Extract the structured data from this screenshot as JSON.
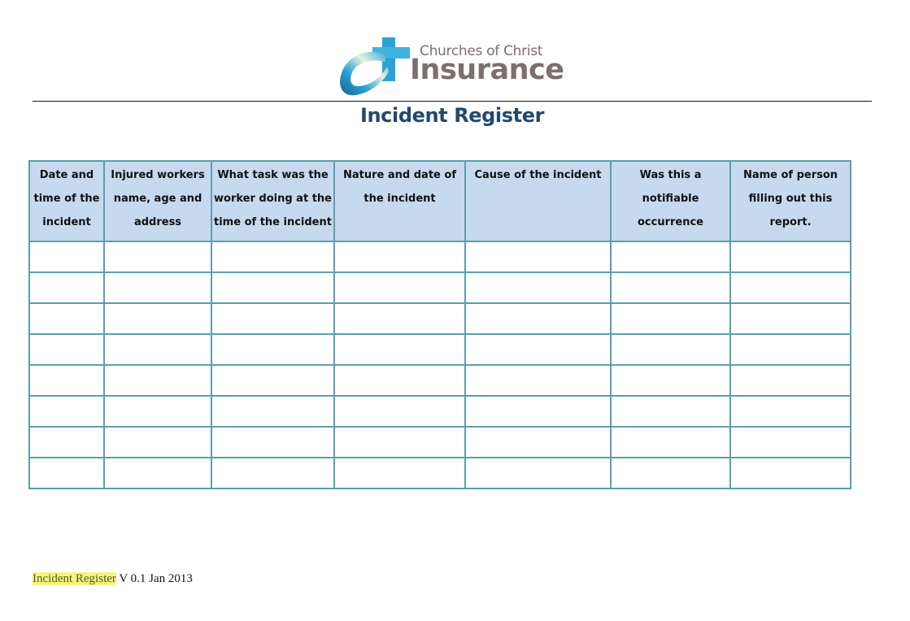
{
  "logo": {
    "line1": "Churches of Christ",
    "line2": "Insurance",
    "icon": "fish-cross-icon",
    "colors": {
      "blue": "#2aa3d9",
      "dark_blue": "#17628a",
      "light": "#d9ecd0",
      "text": "#7a706c"
    }
  },
  "document": {
    "title": "Incident Register",
    "title_color": "#24476f"
  },
  "table": {
    "header_bg": "#c6d9ef",
    "border_color": "#5aa0ac",
    "columns": [
      "Date and time of the incident",
      "Injured workers name, age and address",
      "What task was the worker doing at the time of the incident",
      "Nature and date of the incident",
      "Cause of the incident",
      "Was this a notifiable occurrence",
      "Name of person filling out this report."
    ],
    "rows": [
      [
        "",
        "",
        "",
        "",
        "",
        "",
        ""
      ],
      [
        "",
        "",
        "",
        "",
        "",
        "",
        ""
      ],
      [
        "",
        "",
        "",
        "",
        "",
        "",
        ""
      ],
      [
        "",
        "",
        "",
        "",
        "",
        "",
        ""
      ],
      [
        "",
        "",
        "",
        "",
        "",
        "",
        ""
      ],
      [
        "",
        "",
        "",
        "",
        "",
        "",
        ""
      ],
      [
        "",
        "",
        "",
        "",
        "",
        "",
        ""
      ],
      [
        "",
        "",
        "",
        "",
        "",
        "",
        ""
      ]
    ]
  },
  "footer": {
    "highlighted": "Incident Register",
    "version": " V 0.1 Jan 2013"
  }
}
